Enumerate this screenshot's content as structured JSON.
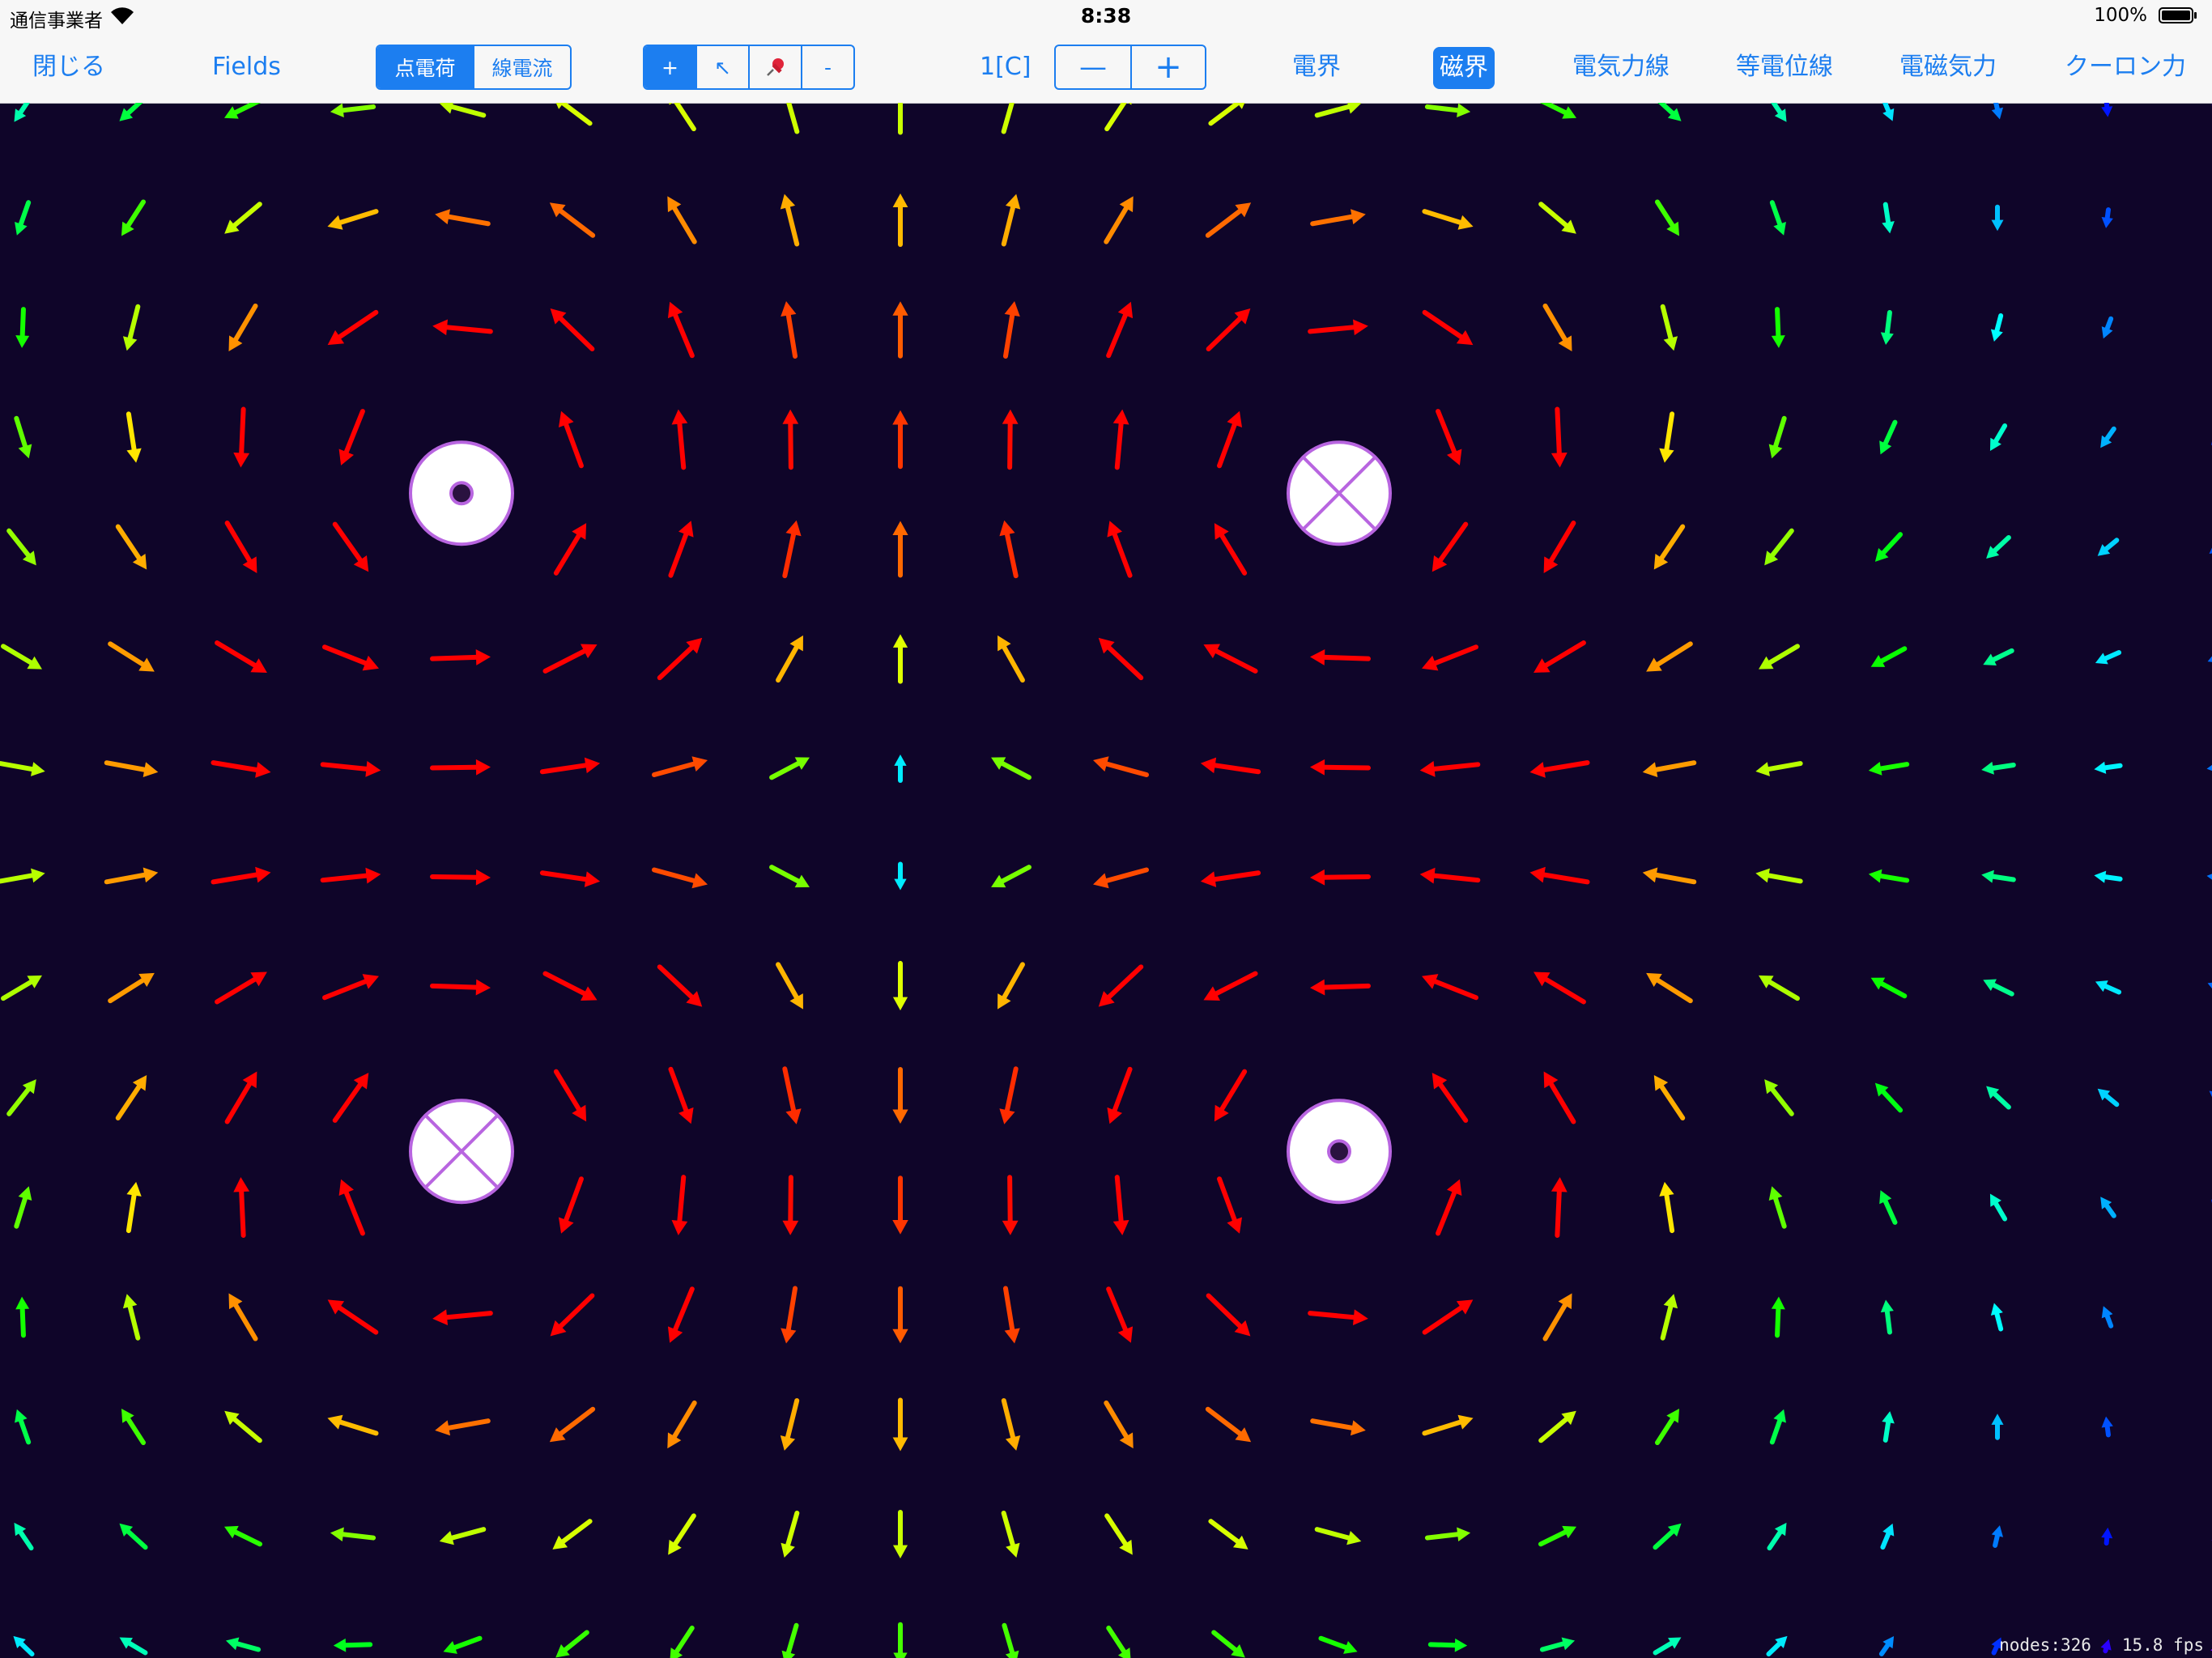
{
  "status_bar": {
    "carrier": "通信事業者",
    "time": "8:38",
    "battery_percent": "100%",
    "wifi_icon": "wifi-icon",
    "battery_icon": "battery-icon"
  },
  "toolbar": {
    "close_label": "閉じる",
    "fields_label": "Fields",
    "object_type": {
      "options": [
        "点電荷",
        "線電流"
      ],
      "selected": 0
    },
    "tools": {
      "options": [
        "+",
        "↖",
        "📌",
        "-"
      ],
      "selected": 0
    },
    "charge_value": "1[C]",
    "stepper": {
      "decrement": "—",
      "increment": "+"
    },
    "modes": {
      "electric_field": "電界",
      "magnetic_field": "磁界",
      "electric_field_lines": "電気力線",
      "equipotential_lines": "等電位線",
      "electromagnetic_force": "電磁気力",
      "coulomb_force": "クーロン力",
      "active": "magnetic_field"
    }
  },
  "simulation": {
    "field_mode": "magnetic",
    "currents": [
      {
        "x": 4,
        "y": 3.5,
        "direction": "out"
      },
      {
        "x": 12,
        "y": 3.5,
        "direction": "in"
      },
      {
        "x": 4,
        "y": 9.5,
        "direction": "in"
      },
      {
        "x": 12,
        "y": 9.5,
        "direction": "out"
      }
    ],
    "grid": {
      "cols": 20,
      "rows": 14
    },
    "out_icon": "current-out-icon",
    "in_icon": "current-in-icon"
  },
  "footer": {
    "nodes": "nodes:326",
    "fps": "15.8 fps"
  }
}
